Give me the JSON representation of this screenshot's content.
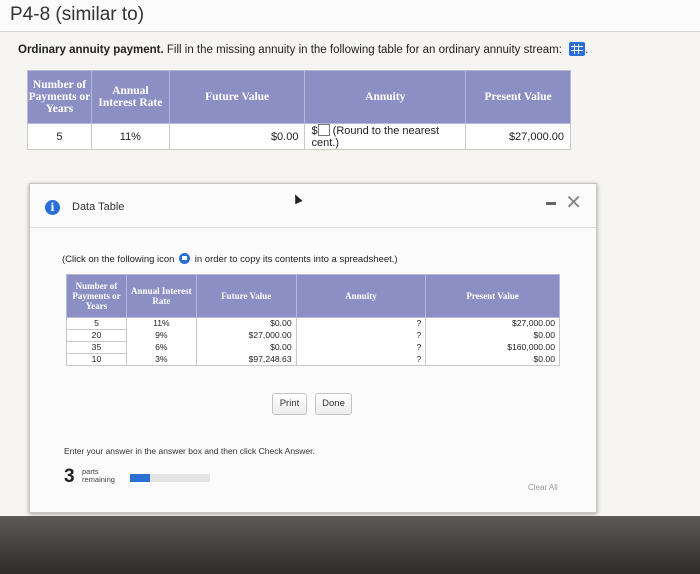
{
  "header": {
    "title": "P4-8 (similar to)"
  },
  "question": {
    "bold": "Ordinary annuity payment.",
    "text": "Fill in the missing annuity in the following table for an ordinary annuity stream:",
    "suffix": "."
  },
  "main_table": {
    "headers": [
      "Number of Payments or Years",
      "Annual Interest Rate",
      "Future Value",
      "Annuity",
      "Present Value"
    ],
    "row": {
      "n": "5",
      "rate": "11%",
      "fv": "$0.00",
      "annuity_prefix": "$",
      "annuity_hint": "(Round to the nearest cent.)",
      "pv": "$27,000.00"
    }
  },
  "dialog": {
    "title": "Data Table",
    "copy_note_before": "(Click on the following icon",
    "copy_note_after": "in order to copy its contents into a spreadsheet.)",
    "headers": [
      "Number of Payments or Years",
      "Annual Interest Rate",
      "Future Value",
      "Annuity",
      "Present Value"
    ],
    "rows": [
      {
        "n": "5",
        "rate": "11%",
        "fv": "$0.00",
        "annuity": "?",
        "pv": "$27,000.00"
      },
      {
        "n": "20",
        "rate": "9%",
        "fv": "$27,000.00",
        "annuity": "?",
        "pv": "$0.00"
      },
      {
        "n": "35",
        "rate": "6%",
        "fv": "$0.00",
        "annuity": "?",
        "pv": "$160,000.00"
      },
      {
        "n": "10",
        "rate": "3%",
        "fv": "$97,248.63",
        "annuity": "?",
        "pv": "$0.00"
      }
    ],
    "print_label": "Print",
    "done_label": "Done"
  },
  "footer": {
    "instruction": "Enter your answer in the answer box and then click Check Answer.",
    "parts_count": "3",
    "parts_label_1": "parts",
    "parts_label_2": "remaining",
    "progress": 0.25,
    "clear_all": "Clear All"
  },
  "colors": {
    "header_bg": "#8b8fc4",
    "accent": "#2a6ed6"
  },
  "icons": [
    "grid-icon",
    "info-icon",
    "minimize-icon",
    "close-icon",
    "copy-icon"
  ]
}
